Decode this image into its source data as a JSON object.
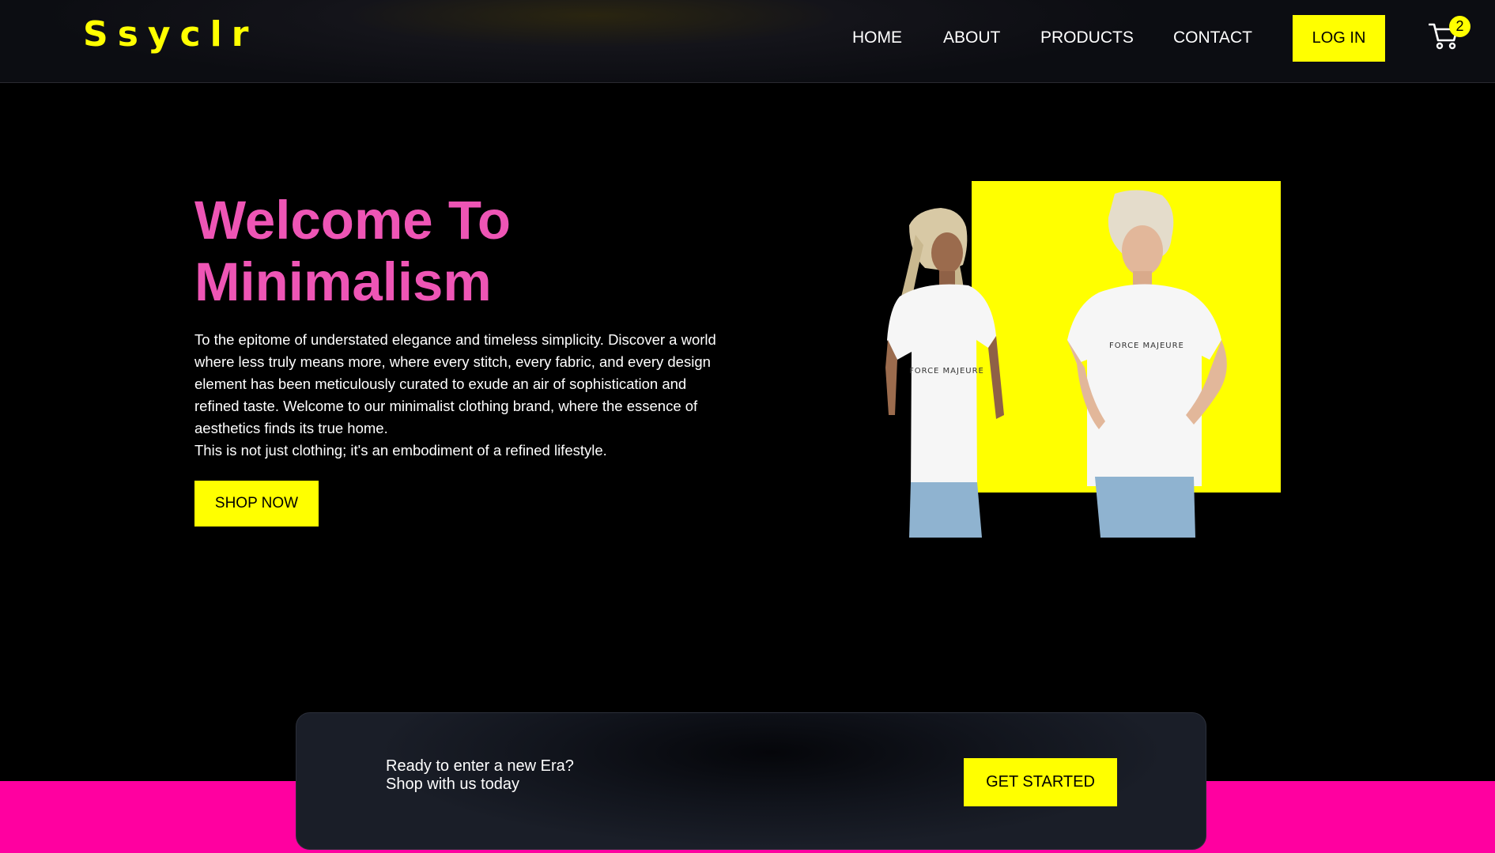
{
  "brand": {
    "logo_text": "Ssyclr"
  },
  "nav": {
    "items": [
      {
        "label": "HOME"
      },
      {
        "label": "ABOUT"
      },
      {
        "label": "PRODUCTS"
      },
      {
        "label": "CONTACT"
      }
    ],
    "login_label": "LOG IN",
    "cart_count": "2"
  },
  "hero": {
    "title_line1": "Welcome To",
    "title_line2": "Minimalism",
    "description": "To the epitome of understated elegance and timeless simplicity. Discover a world where less truly means more, where every stitch, every fabric, and every design element has been meticulously curated to exude an air of sophistication and refined taste. Welcome to our minimalist clothing brand, where the essence of aesthetics finds its true home.",
    "description_line2": "This is not just clothing; it's an embodiment of a refined lifestyle.",
    "shop_label": "SHOP NOW",
    "shirt_print": "FORCE MAJEURE"
  },
  "cta": {
    "line1": "Ready to enter a new Era?",
    "line2": "Shop with us today",
    "button_label": "GET STARTED"
  },
  "colors": {
    "accent_yellow": "#ffff00",
    "title_pink": "#ee55b5",
    "band_pink": "#ff00a0",
    "background": "#000000"
  }
}
